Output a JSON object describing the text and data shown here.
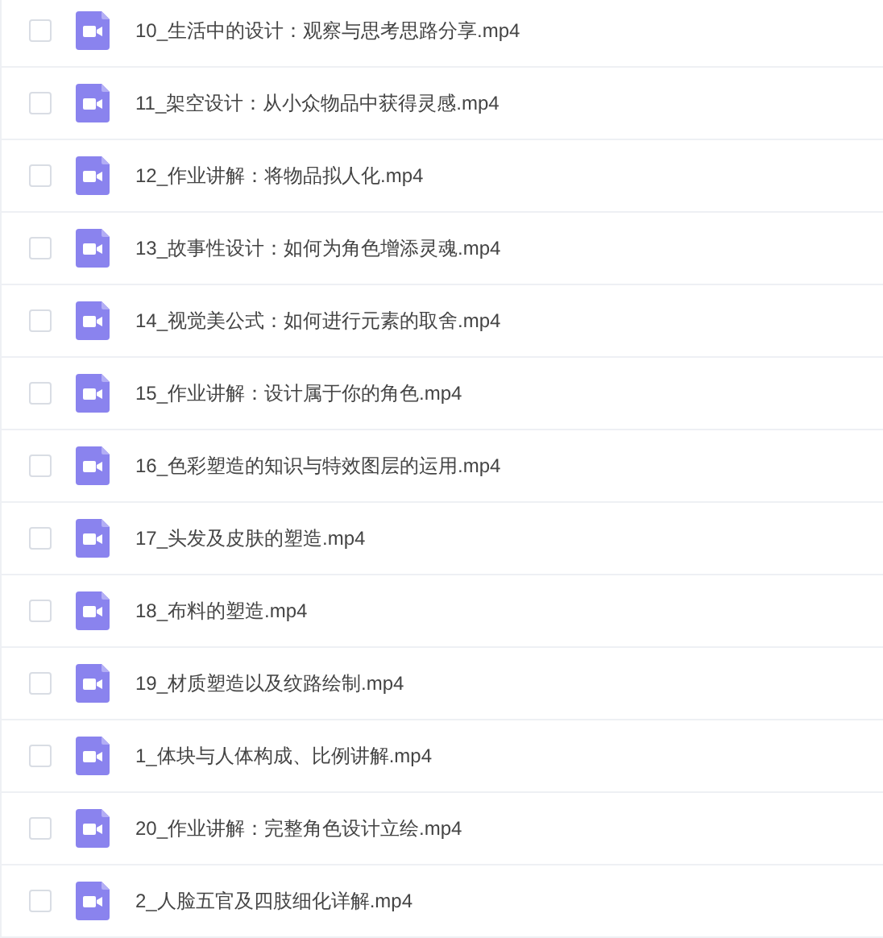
{
  "files": [
    {
      "name": "10_生活中的设计：观察与思考思路分享.mp4",
      "checked": false
    },
    {
      "name": "11_架空设计：从小众物品中获得灵感.mp4",
      "checked": false
    },
    {
      "name": "12_作业讲解：将物品拟人化.mp4",
      "checked": false
    },
    {
      "name": "13_故事性设计：如何为角色增添灵魂.mp4",
      "checked": false
    },
    {
      "name": "14_视觉美公式：如何进行元素的取舍.mp4",
      "checked": false
    },
    {
      "name": "15_作业讲解：设计属于你的角色.mp4",
      "checked": false
    },
    {
      "name": "16_色彩塑造的知识与特效图层的运用.mp4",
      "checked": false
    },
    {
      "name": "17_头发及皮肤的塑造.mp4",
      "checked": false
    },
    {
      "name": "18_布料的塑造.mp4",
      "checked": false
    },
    {
      "name": "19_材质塑造以及纹路绘制.mp4",
      "checked": false
    },
    {
      "name": "1_体块与人体构成、比例讲解.mp4",
      "checked": false
    },
    {
      "name": "20_作业讲解：完整角色设计立绘.mp4",
      "checked": false
    },
    {
      "name": "2_人脸五官及四肢细化详解.mp4",
      "checked": false
    }
  ]
}
